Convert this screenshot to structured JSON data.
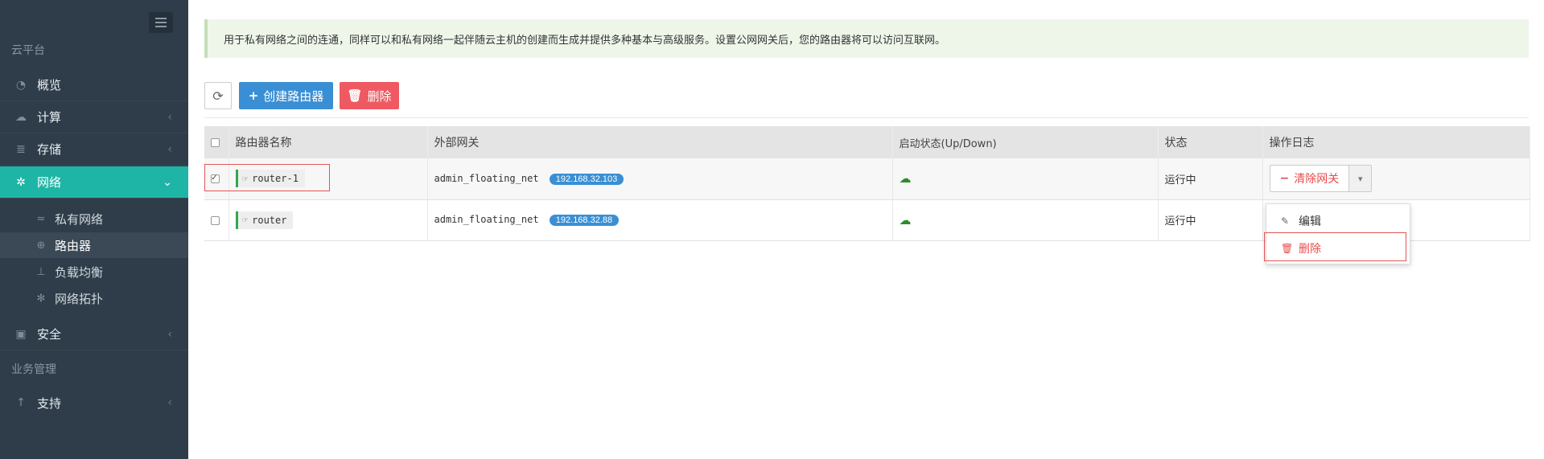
{
  "sidebar": {
    "section_cloud": "云平台",
    "section_business": "业务管理",
    "items": [
      {
        "label": "概览",
        "icon": "dashboard-icon"
      },
      {
        "label": "计算",
        "icon": "cloud-icon"
      },
      {
        "label": "存储",
        "icon": "database-icon"
      },
      {
        "label": "网络",
        "icon": "network-icon"
      },
      {
        "label": "安全",
        "icon": "briefcase-icon"
      },
      {
        "label": "支持",
        "icon": "pin-icon"
      }
    ],
    "network_sub": [
      {
        "label": "私有网络",
        "icon": "rss-icon"
      },
      {
        "label": "路由器",
        "icon": "globe-icon"
      },
      {
        "label": "负载均衡",
        "icon": "sitemap-icon"
      },
      {
        "label": "网络拓扑",
        "icon": "topology-icon"
      }
    ]
  },
  "notice": "用于私有网络之间的连通，同样可以和私有网络一起伴随云主机的创建而生成并提供多种基本与高级服务。设置公网网关后，您的路由器将可以访问互联网。",
  "toolbar": {
    "create_label": "创建路由器",
    "delete_label": "删除"
  },
  "table": {
    "headers": [
      "路由器名称",
      "外部网关",
      "启动状态(Up/Down)",
      "状态",
      "操作日志"
    ],
    "rows": [
      {
        "name": "router-1",
        "gateway": "admin_floating_net",
        "ip": "192.168.32.103",
        "status": "运行中",
        "checked": true
      },
      {
        "name": "router",
        "gateway": "admin_floating_net",
        "ip": "192.168.32.88",
        "status": "运行中",
        "checked": false
      }
    ]
  },
  "action": {
    "clear_gateway": "清除网关",
    "menu_edit": "编辑",
    "menu_delete": "删除"
  },
  "colors": {
    "sidebar_bg": "#2f3d4a",
    "active_teal": "#1fb5a6",
    "primary_blue": "#3a8fd4",
    "danger_red": "#ef5a62",
    "up_green": "#2f8a2f"
  }
}
